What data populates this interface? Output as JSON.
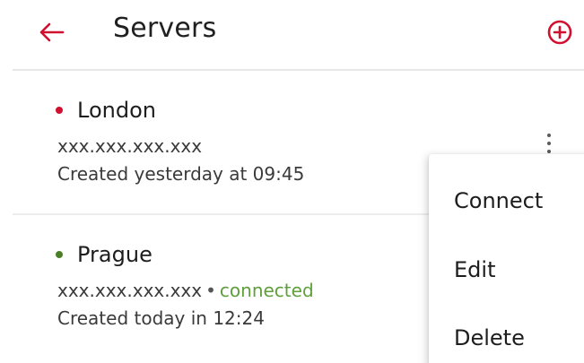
{
  "header": {
    "title": "Servers",
    "back_icon": "arrow-left-icon",
    "add_icon": "plus-circle-icon"
  },
  "colors": {
    "accent": "#d0102e",
    "status_offline": "#d0102e",
    "status_online": "#4b7f26",
    "connected_text": "#5f9f3b"
  },
  "servers": [
    {
      "name": "London",
      "status": "offline",
      "address": "xxx.xxx.xxx.xxx",
      "connection_text": "",
      "created": "Created yesterday at 09:45"
    },
    {
      "name": "Prague",
      "status": "online",
      "address": "xxx.xxx.xxx.xxx",
      "separator": "•",
      "connection_text": "connected",
      "created": "Created today in 12:24"
    }
  ],
  "context_menu": {
    "items": [
      {
        "label": "Connect"
      },
      {
        "label": "Edit"
      },
      {
        "label": "Delete"
      }
    ]
  }
}
